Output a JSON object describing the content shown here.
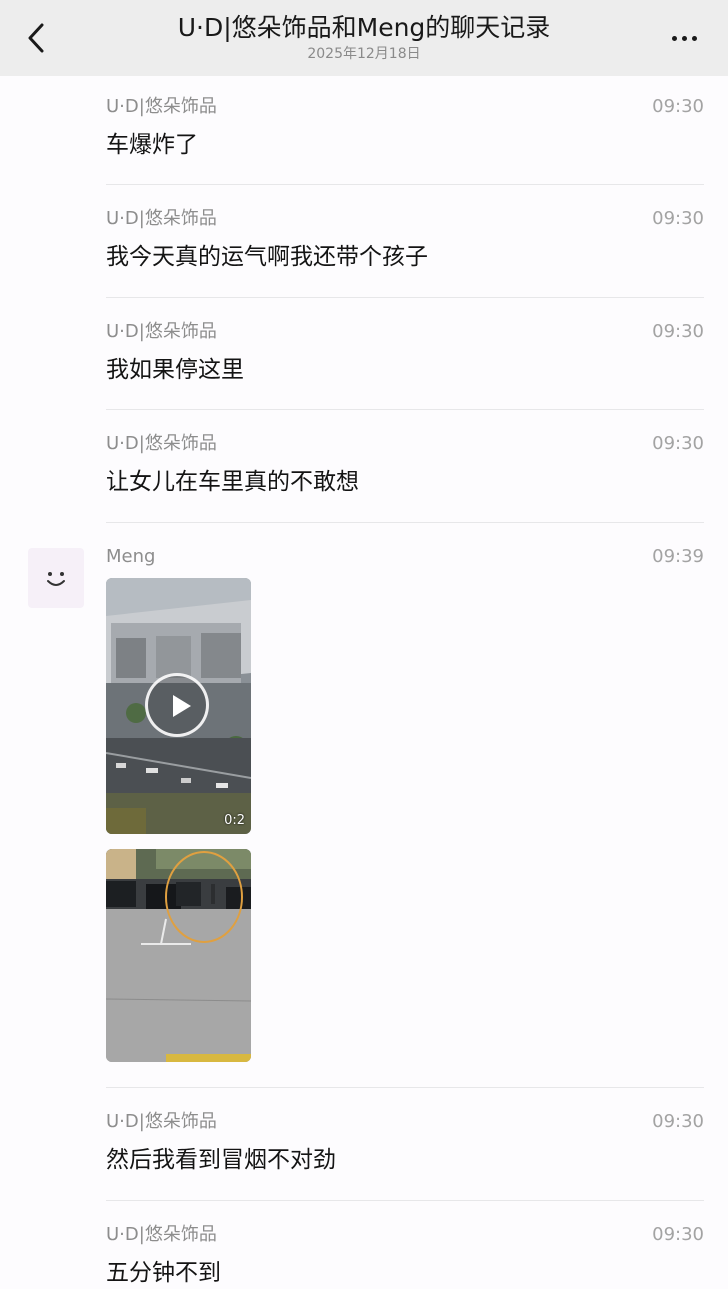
{
  "header": {
    "title": "U·D|悠朵饰品和Meng的聊天记录",
    "date": "2025年12月18日",
    "back_icon": "chevron-left-icon",
    "more_icon": "more-dots-icon"
  },
  "messages": [
    {
      "sender": "U·D|悠朵饰品",
      "time": "09:30",
      "text": "车爆炸了"
    },
    {
      "sender": "U·D|悠朵饰品",
      "time": "09:30",
      "text": "我今天真的运气啊我还带个孩子"
    },
    {
      "sender": "U·D|悠朵饰品",
      "time": "09:30",
      "text": "我如果停这里"
    },
    {
      "sender": "U·D|悠朵饰品",
      "time": "09:30",
      "text": "让女儿在车里真的不敢想"
    },
    {
      "sender": "Meng",
      "time": "09:39",
      "avatar_icon": "smiley-face-icon",
      "video_duration": "0:2",
      "video_icon": "play-icon",
      "image_subject": "parking lot with circled car"
    },
    {
      "sender": "U·D|悠朵饰品",
      "time": "09:30",
      "text": "然后我看到冒烟不对劲"
    },
    {
      "sender": "U·D|悠朵饰品",
      "time": "09:30",
      "text": "五分钟不到"
    }
  ]
}
